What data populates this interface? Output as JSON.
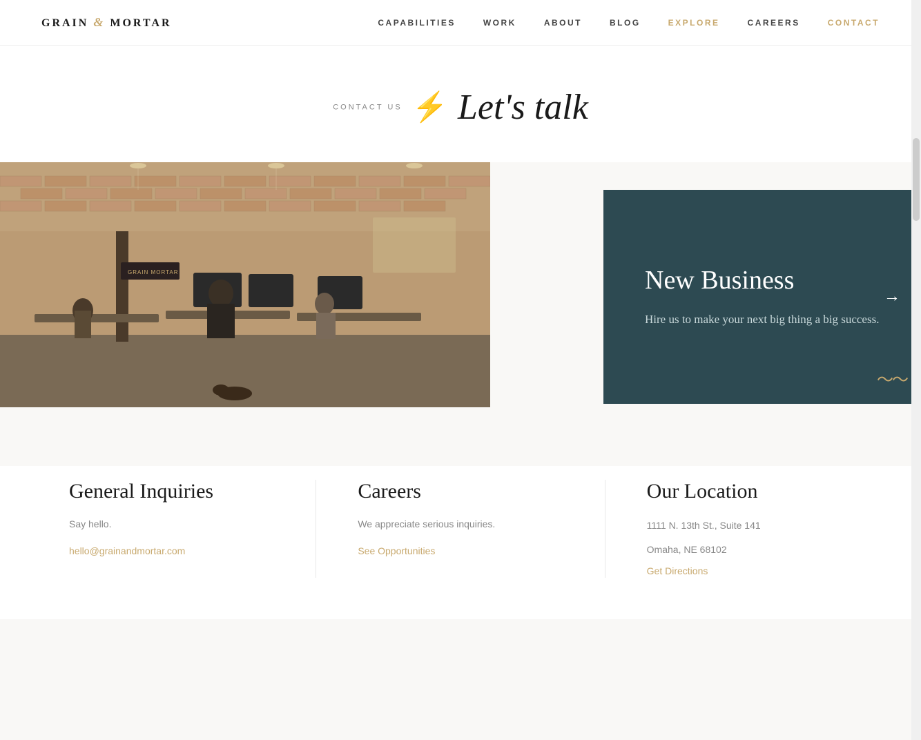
{
  "logo": {
    "text_before": "GRAIN",
    "ampersand": "&",
    "text_after": "MORTAR"
  },
  "nav": {
    "links": [
      {
        "label": "CAPABILITIES",
        "active": false
      },
      {
        "label": "WORK",
        "active": false
      },
      {
        "label": "ABOUT",
        "active": false
      },
      {
        "label": "BLOG",
        "active": false
      },
      {
        "label": "EXPLORE",
        "active": true,
        "class": "active-explore"
      },
      {
        "label": "CAREERS",
        "active": false
      },
      {
        "label": "CONTACT",
        "active": true,
        "class": "active-contact"
      }
    ]
  },
  "hero": {
    "eyebrow": "CONTACT US",
    "title": "Let's talk"
  },
  "new_business_card": {
    "title": "New Business",
    "description": "Hire us to make your next big thing a big success.",
    "arrow": "→"
  },
  "contact_columns": [
    {
      "id": "general-inquiries",
      "heading": "General Inquiries",
      "subtext": "Say hello.",
      "link_label": "hello@grainandmortar.com",
      "link_href": "mailto:hello@grainandmortar.com"
    },
    {
      "id": "careers",
      "heading": "Careers",
      "subtext": "We appreciate serious inquiries.",
      "link_label": "See Opportunities",
      "link_href": "#"
    },
    {
      "id": "our-location",
      "heading": "Our Location",
      "address_line1": "1111 N. 13th St., Suite 141",
      "address_line2": "Omaha, NE 68102",
      "link_label": "Get Directions",
      "link_href": "#"
    }
  ],
  "colors": {
    "gold": "#c8a96e",
    "dark_teal": "#2d4a52",
    "dark_text": "#1a1a1a",
    "gray_text": "#888"
  }
}
